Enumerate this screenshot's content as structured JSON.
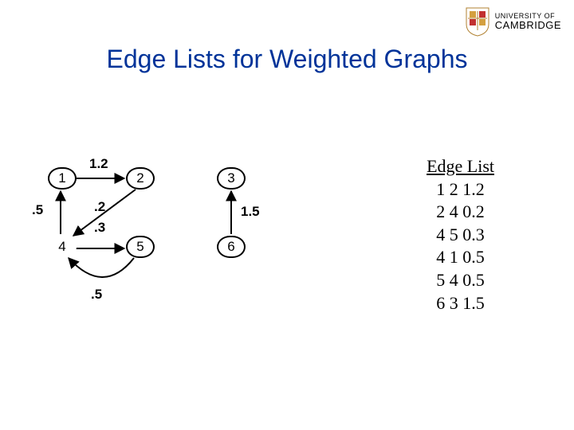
{
  "logo": {
    "line1": "UNIVERSITY OF",
    "line2": "CAMBRIDGE"
  },
  "title": "Edge Lists for Weighted Graphs",
  "graph": {
    "nodes": {
      "n1": "1",
      "n2": "2",
      "n3": "3",
      "n4": "4",
      "n5": "5",
      "n6": "6"
    },
    "weights": {
      "w12": "1.2",
      "w24": ".2",
      "w45": ".3",
      "w41": ".5",
      "w54": ".5",
      "w63": "1.5"
    }
  },
  "edgelist": {
    "header": "Edge List",
    "rows": [
      "1 2 1.2",
      "2 4 0.2",
      "4 5 0.3",
      "4 1 0.5",
      "5 4 0.5",
      "6 3 1.5"
    ]
  }
}
